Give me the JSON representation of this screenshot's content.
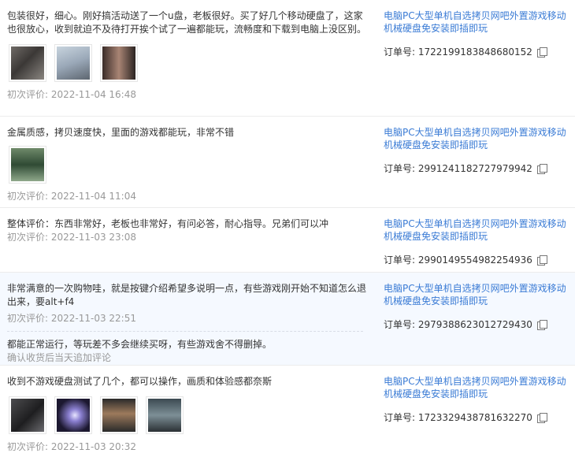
{
  "reviews": [
    {
      "text": "包装很好，细心。刚好搞活动送了一个u盘，老板很好。买了好几个移动硬盘了，这家也很放心，收到就迫不及待打开挨个试了一遍都能玩，流畅度和下载到电脑上没区别。",
      "time": "初次评价: 2022-11-04 16:48",
      "product": "电脑PC大型单机自选拷贝网吧外置游戏移动机械硬盘免安装即插即玩",
      "order": "订单号: 1722199183848680152",
      "images": [
        "review-photo-1",
        "review-photo-2",
        "review-photo-3"
      ]
    },
    {
      "text": "金属质感，拷贝速度快，里面的游戏都能玩，非常不错",
      "time": "初次评价: 2022-11-04 11:04",
      "product": "电脑PC大型单机自选拷贝网吧外置游戏移动机械硬盘免安装即插即玩",
      "order": "订单号: 2991241182727979942",
      "images": [
        "review-photo-1"
      ]
    },
    {
      "text": "整体评价：东西非常好，老板也非常好，有问必答，耐心指导。兄弟们可以冲",
      "time": "初次评价: 2022-11-03 23:08",
      "product": "电脑PC大型单机自选拷贝网吧外置游戏移动机械硬盘免安装即插即玩",
      "order": "订单号: 2990149554982254936"
    },
    {
      "text": "非常满意的一次购物哇，就是按键介绍希望多说明一点，有些游戏刚开始不知道怎么退出来，要alt+f4",
      "time": "初次评价: 2022-11-03 22:51",
      "additional_text": "都能正常运行，等玩差不多会继续买呀，有些游戏舍不得删掉。",
      "additional_meta": "确认收货后当天追加评论",
      "product": "电脑PC大型单机自选拷贝网吧外置游戏移动机械硬盘免安装即插即玩",
      "order": "订单号: 2979388623012729430"
    },
    {
      "text": "收到不游戏硬盘测试了几个，都可以操作，画质和体验感都奈斯",
      "time": "初次评价: 2022-11-03 20:32",
      "product": "电脑PC大型单机自选拷贝网吧外置游戏移动机械硬盘免安装即插即玩",
      "order": "订单号: 1723329438781632270",
      "images": [
        "review-photo-1",
        "review-photo-2",
        "review-photo-3",
        "review-photo-4"
      ]
    }
  ],
  "icons": {
    "copy": "copy-icon"
  }
}
